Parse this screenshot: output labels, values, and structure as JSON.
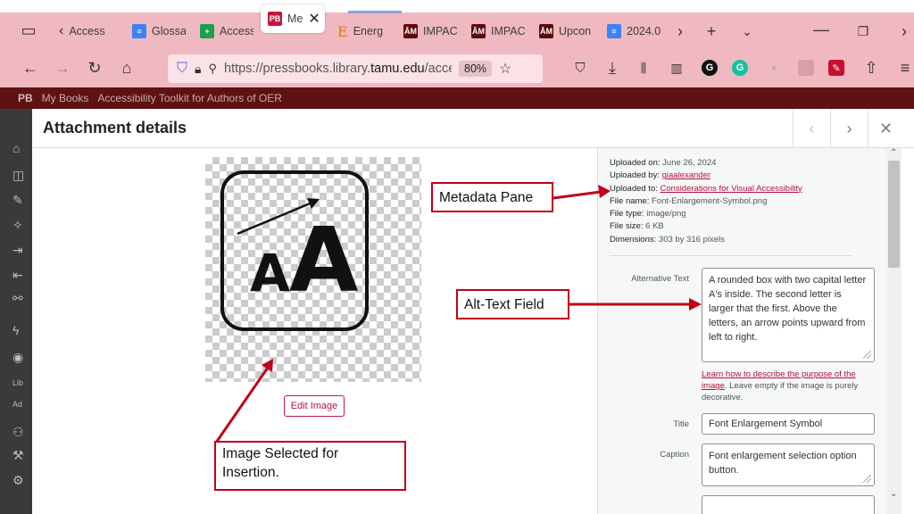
{
  "browser": {
    "tabs": [
      {
        "label": "Access",
        "icon": "back-chevron"
      },
      {
        "label": "Glossa",
        "icon": "docs-icon",
        "color": "#3b82f6"
      },
      {
        "label": "Access",
        "icon": "sheets-icon",
        "color": "#1e9e4a"
      },
      {
        "label": "Me",
        "icon": "pressbooks-icon",
        "color": "#c4163a",
        "active": true,
        "favicon_text": "PB"
      },
      {
        "label": "Energ",
        "icon": "energy-icon",
        "color": "#e07a1a",
        "favicon_text": "E"
      },
      {
        "label": "IMPAC",
        "icon": "tamu-icon",
        "color": "#5c0a0a"
      },
      {
        "label": "IMPAC",
        "icon": "tamu-icon",
        "color": "#5c0a0a"
      },
      {
        "label": "Upcon",
        "icon": "tamu-icon",
        "color": "#5c0a0a"
      },
      {
        "label": "2024.0",
        "icon": "docs-icon",
        "color": "#3b82f6"
      }
    ],
    "url_prefix": "https://pressbooks.library.",
    "url_domain": "tamu.edu",
    "url_suffix": "/acce",
    "zoom": "80%"
  },
  "wp": {
    "adminbar_books": "My Books",
    "adminbar_title": "Accessibility Toolkit for Authors of OER",
    "side_labels": [
      "Lib",
      "Ad"
    ]
  },
  "modal": {
    "title": "Attachment details",
    "edit_image_label": "Edit Image",
    "meta": {
      "uploaded_on_label": "Uploaded on:",
      "uploaded_on": "June 26, 2024",
      "uploaded_by_label": "Uploaded by:",
      "uploaded_by": "giaalexander",
      "uploaded_to_label": "Uploaded to:",
      "uploaded_to": "Considerations for Visual Accessibility",
      "file_name_label": "File name:",
      "file_name": "Font-Enlargement-Symbol.png",
      "file_type_label": "File type:",
      "file_type": "image/png",
      "file_size_label": "File size:",
      "file_size": "6 KB",
      "dimensions_label": "Dimensions:",
      "dimensions": "303 by 316 pixels"
    },
    "alt_text_label": "Alternative Text",
    "alt_text_value": "A rounded box with two capital letter A's inside. The second letter is larger that the first. Above the letters, an arrow points upward from left to right.",
    "help_link": "Learn how to describe the purpose of the image",
    "help_rest": ". Leave empty if the image is purely decorative.",
    "title_label": "Title",
    "title_value": "Font Enlargement Symbol",
    "caption_label": "Caption",
    "caption_value": "Font enlargement selection option button."
  },
  "annotations": {
    "metadata": "Metadata Pane",
    "alt_text": "Alt-Text Field",
    "image_selected": "Image Selected for Insertion."
  },
  "colors": {
    "annotation": "#c0001a",
    "browser_chrome": "#f0b8c0",
    "link": "#b3123c"
  }
}
